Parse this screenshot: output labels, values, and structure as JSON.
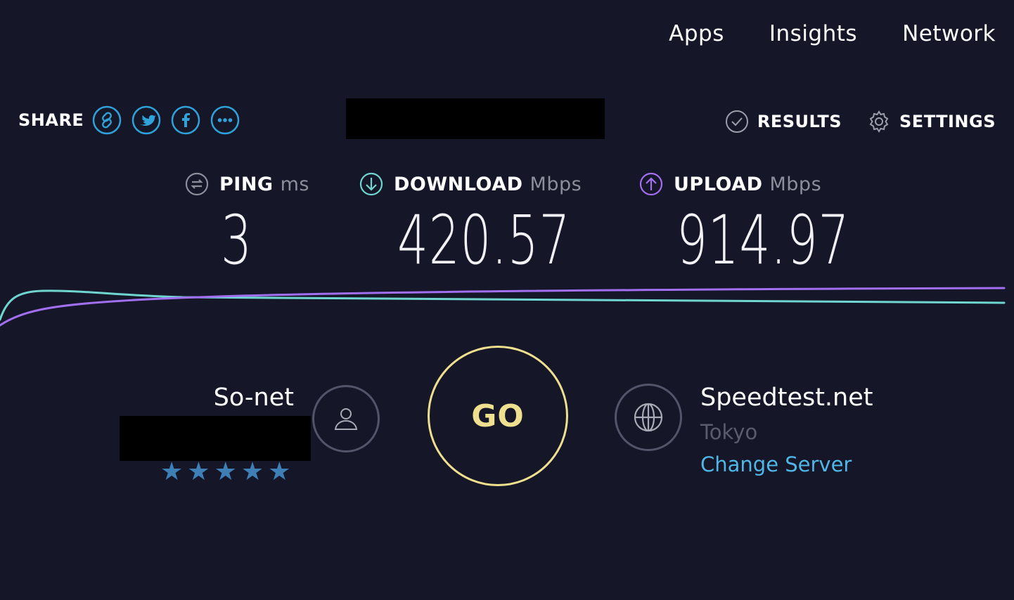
{
  "nav": {
    "items": [
      "Apps",
      "Insights",
      "Network"
    ]
  },
  "share": {
    "label": "SHARE",
    "buttons": [
      "link-icon",
      "twitter-icon",
      "facebook-icon",
      "more-icon"
    ],
    "color": "#2fa3d9"
  },
  "toolbar": {
    "results_label": "RESULTS",
    "settings_label": "SETTINGS"
  },
  "metrics": {
    "ping": {
      "label": "PING",
      "unit": "ms",
      "value": "3"
    },
    "download": {
      "label": "DOWNLOAD",
      "unit": "Mbps",
      "value": "420.57",
      "color": "#6fd6cf"
    },
    "upload": {
      "label": "UPLOAD",
      "unit": "Mbps",
      "value": "914.97",
      "color": "#a16ff0"
    }
  },
  "isp": {
    "name": "So-net",
    "rating": 5,
    "star_color": "#3e7fb5"
  },
  "go_label": "GO",
  "server": {
    "name": "Speedtest.net",
    "location": "Tokyo",
    "change_label": "Change Server"
  }
}
